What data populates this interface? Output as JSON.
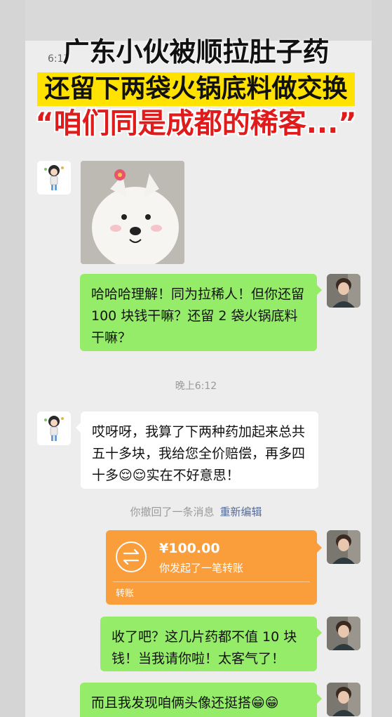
{
  "overlay": {
    "line1": "广东小伙被顺拉肚子药",
    "line2": "还留下两袋火锅底料做交换",
    "line3": "“咱们同是成都的稀客...”"
  },
  "status": {
    "time": "6:17"
  },
  "chat": {
    "msg_green_1": "哈哈哈理解！同为拉稀人！但你还留 100 块钱干嘛？还留 2 袋火锅底料干嘛？",
    "timestamp": "晚上6:12",
    "msg_white_1": "哎呀呀，我算了下两种药加起来总共五十多块，我给您全价赔偿，再多四十多😌😌实在不好意思！",
    "recall_text": "你撤回了一条消息",
    "recall_edit": "重新编辑",
    "transfer": {
      "amount": "¥100.00",
      "desc": "你发起了一笔转账",
      "label": "转账"
    },
    "msg_green_2": "收了吧？这几片药都不值 10 块钱！当我请你啦！太客气了！",
    "msg_green_3": "而且我发现咱俩头像还挺搭😁😁"
  },
  "colors": {
    "chat_bg": "#ededed",
    "green_bubble": "#95ec69",
    "transfer_orange": "#fa9d3b",
    "headline_yellow": "#ffe200",
    "headline_red": "#e01b1b"
  }
}
